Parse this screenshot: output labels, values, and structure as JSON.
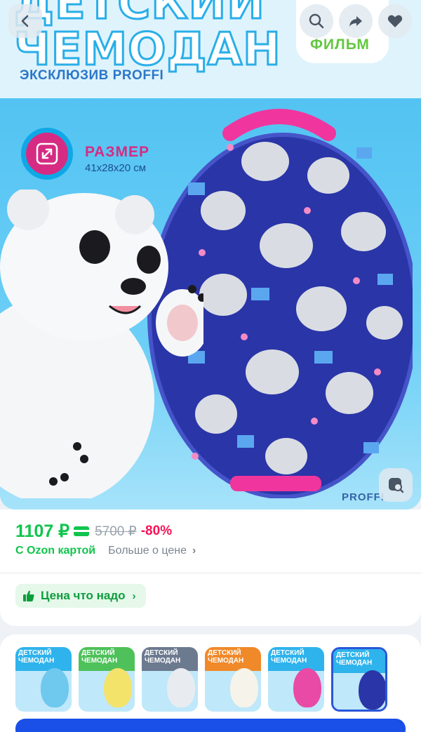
{
  "hero": {
    "title_line1": "ДЕТСКИЙ",
    "title_line2": "ЧЕМОДАН",
    "subtitle": "ЭКСКЛЮЗИВ PROFFI",
    "brand_logo_text": "ФИЛЬМ",
    "size_label": "РАЗМЕР",
    "size_value": "41x28x20 см",
    "watermark": "PROFFI"
  },
  "toolbar": {
    "back_icon": "chevron-left-icon",
    "search_icon": "search-icon",
    "share_icon": "share-icon",
    "favorite_icon": "heart-icon",
    "visual_search_icon": "image-search-icon"
  },
  "price": {
    "current": "1107 ₽",
    "old": "5700 ₽",
    "discount": "-80%",
    "ozon_card": "С Ozon картой",
    "more_about_price": "Больше о цене",
    "good_price_badge": "Цена что надо"
  },
  "thumbnails": [
    {
      "title": "ДЕТСКИЙ ЧЕМОДАН",
      "color": "#2fb3ec"
    },
    {
      "title": "ДЕТСКИЙ ЧЕМОДАН",
      "color": "#4ec15a"
    },
    {
      "title": "ДЕТСКИЙ ЧЕМОДАН",
      "color": "#6c7a90"
    },
    {
      "title": "ДЕТСКИЙ ЧЕМОДАН",
      "color": "#f0892a"
    },
    {
      "title": "ДЕТСКИЙ ЧЕМОДАН",
      "color": "#2fb3ec"
    },
    {
      "title": "ДЕТСКИЙ ЧЕМОДАН",
      "color": "#2fb3ec",
      "selected": true
    }
  ],
  "colors": {
    "accent_green": "#10c44c",
    "discount_red": "#f91155",
    "primary_blue": "#1a4fe8"
  }
}
